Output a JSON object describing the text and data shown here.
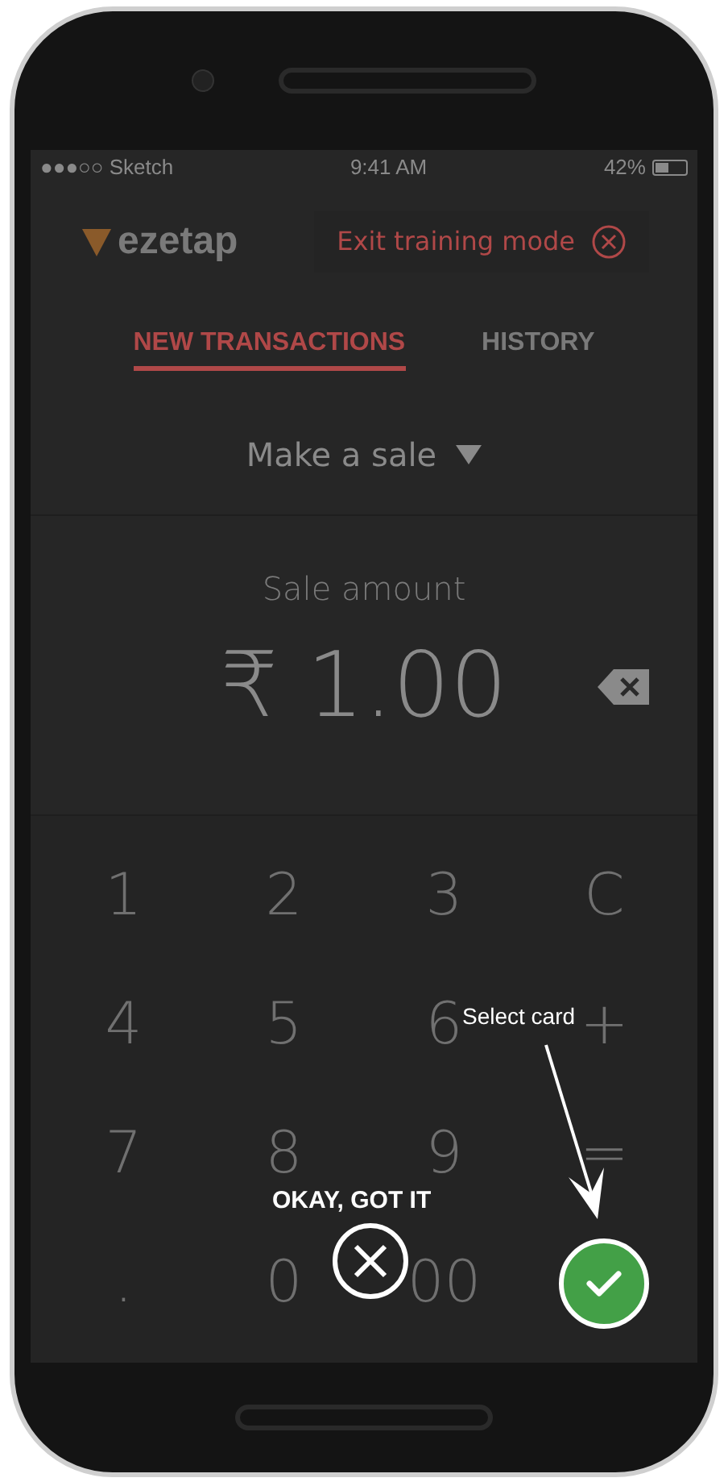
{
  "status_bar": {
    "carrier": "●●●○○ Sketch",
    "time": "9:41 AM",
    "battery": "42%"
  },
  "header": {
    "logo": "ezetap",
    "exit_button": "Exit training mode"
  },
  "tabs": [
    {
      "label": "NEW TRANSACTIONS",
      "selected": true
    },
    {
      "label": "HISTORY",
      "selected": false
    }
  ],
  "mode_dropdown": "Make a sale",
  "amount": {
    "label": "Sale amount",
    "value": "₹ 1.00"
  },
  "keypad": [
    {
      "kind": "key",
      "label": "1"
    },
    {
      "kind": "key",
      "label": "2"
    },
    {
      "kind": "key",
      "label": "3"
    },
    {
      "kind": "key",
      "label": "C"
    },
    {
      "kind": "key",
      "label": "4"
    },
    {
      "kind": "key",
      "label": "5"
    },
    {
      "kind": "key",
      "label": "6"
    },
    {
      "kind": "key",
      "label": "+"
    },
    {
      "kind": "key",
      "label": "7"
    },
    {
      "kind": "key",
      "label": "8"
    },
    {
      "kind": "key",
      "label": "9"
    },
    {
      "kind": "key",
      "label": "="
    },
    {
      "kind": "key",
      "label": "."
    },
    {
      "kind": "key",
      "label": "0"
    },
    {
      "kind": "key",
      "label": "00"
    },
    {
      "kind": "confirm"
    }
  ],
  "coach": {
    "dismiss_label": "OKAY, GOT IT",
    "hint": "Select card"
  }
}
